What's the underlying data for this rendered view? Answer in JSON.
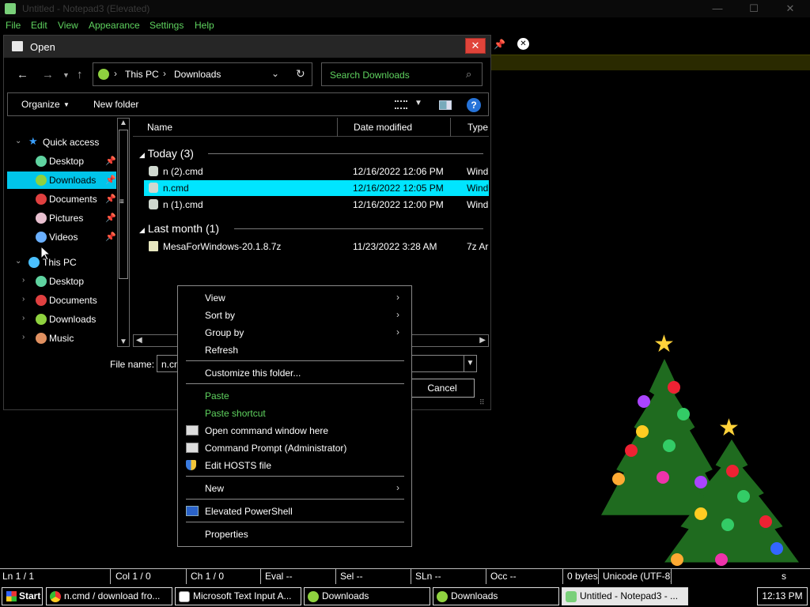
{
  "notepad": {
    "title": "Untitled - Notepad3 (Elevated)",
    "menu": [
      "File",
      "Edit",
      "View",
      "Appearance",
      "Settings",
      "Help"
    ],
    "window_controls": {
      "minimize": "—",
      "maximize": "☐",
      "close": "✕"
    }
  },
  "dialog": {
    "title": "Open",
    "close": "✕",
    "address": {
      "crumbs": [
        "This PC",
        "Downloads"
      ]
    },
    "search_placeholder": "Search Downloads",
    "commands": {
      "organize": "Organize",
      "new_folder": "New folder",
      "help": "?"
    },
    "nav": {
      "quick_access": "Quick access",
      "quick_items": [
        "Desktop",
        "Downloads",
        "Documents",
        "Pictures",
        "Videos"
      ],
      "this_pc": "This PC",
      "pc_items": [
        "Desktop",
        "Documents",
        "Downloads",
        "Music"
      ]
    },
    "columns": [
      "Name",
      "Date modified",
      "Type"
    ],
    "groups": [
      {
        "label": "Today (3)",
        "files": [
          {
            "name": "n (2).cmd",
            "date": "12/16/2022 12:06 PM",
            "type": "Wind"
          },
          {
            "name": "n.cmd",
            "date": "12/16/2022 12:05 PM",
            "type": "Wind"
          },
          {
            "name": "n (1).cmd",
            "date": "12/16/2022 12:00 PM",
            "type": "Wind"
          }
        ]
      },
      {
        "label": "Last month (1)",
        "files": [
          {
            "name": "MesaForWindows-20.1.8.7z",
            "date": "11/23/2022 3:28 AM",
            "type": "7z Ar"
          }
        ]
      }
    ],
    "file_name_label": "File name:",
    "file_name_value": "n.cm",
    "cancel": "Cancel"
  },
  "context_menu": {
    "items": [
      "View",
      "Sort by",
      "Group by",
      "Refresh",
      "Customize this folder...",
      "Paste",
      "Paste shortcut",
      "Open command window here",
      "Command Prompt (Administrator)",
      "Edit HOSTS file",
      "New",
      "Elevated PowerShell",
      "Properties"
    ]
  },
  "statusbar": {
    "ln": "Ln  1 / 1",
    "col": "Col  1 / 0",
    "ch": "Ch  1 / 0",
    "eval": "Eval  --",
    "sel": "Sel  --",
    "sln": "SLn  --",
    "occ": "Occ  --",
    "bytes": "0 bytes",
    "encoding": "Unicode (UTF-8)",
    "extra": "s"
  },
  "taskbar": {
    "start": "Start",
    "items": [
      "n.cmd / download fro...",
      "Microsoft Text Input A...",
      "Downloads",
      "Downloads",
      "Untitled - Notepad3 - ..."
    ],
    "clock": "12:13 PM"
  },
  "colors": {
    "accent": "#00e5ff",
    "green_text": "#5fd35f",
    "close_red": "#e0443a"
  }
}
